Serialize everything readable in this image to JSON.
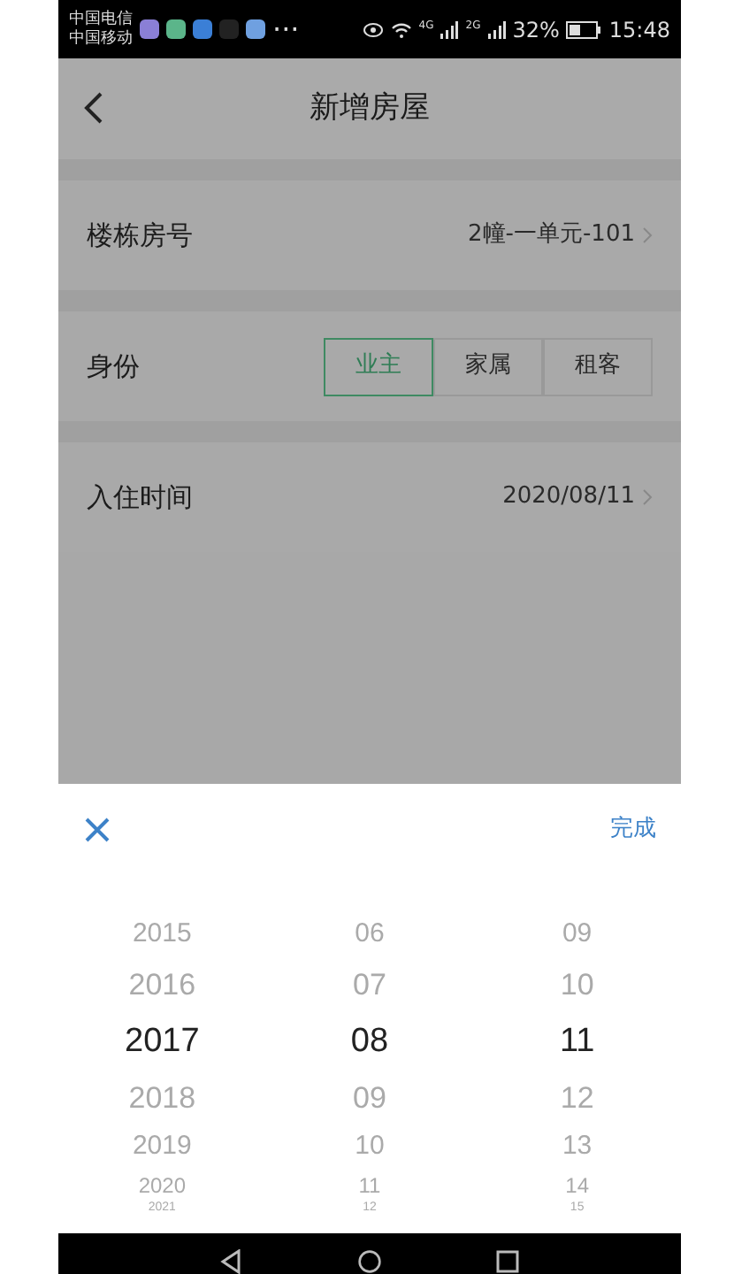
{
  "status_bar": {
    "carriers": [
      "中国电信",
      "中国移动"
    ],
    "more": "···",
    "signal_labels": [
      "4G",
      "2G"
    ],
    "battery": "32%",
    "time": "15:48"
  },
  "header": {
    "title": "新增房屋"
  },
  "form": [
    {
      "kind": "value",
      "label": "楼栋房号",
      "value": "2幢-一单元-101"
    },
    {
      "kind": "segmented",
      "label": "身份",
      "options": [
        {
          "label": "业主",
          "selected": true
        },
        {
          "label": "家属",
          "selected": false
        },
        {
          "label": "租客",
          "selected": false
        }
      ]
    },
    {
      "kind": "value",
      "label": "入住时间",
      "value": "2020/08/11"
    }
  ],
  "sheet": {
    "confirm": "完成",
    "columns": [
      {
        "items": [
          {
            "text": "2015",
            "selected": false
          },
          {
            "text": "2016",
            "selected": false
          },
          {
            "text": "2017",
            "selected": true
          },
          {
            "text": "2018",
            "selected": false
          },
          {
            "text": "2019",
            "selected": false
          },
          {
            "text": "2020",
            "selected": false
          },
          {
            "text": "2021",
            "selected": false
          }
        ]
      },
      {
        "items": [
          {
            "text": "06",
            "selected": false
          },
          {
            "text": "07",
            "selected": false
          },
          {
            "text": "08",
            "selected": true
          },
          {
            "text": "09",
            "selected": false
          },
          {
            "text": "10",
            "selected": false
          },
          {
            "text": "11",
            "selected": false
          },
          {
            "text": "12",
            "selected": false
          }
        ]
      },
      {
        "items": [
          {
            "text": "09",
            "selected": false
          },
          {
            "text": "10",
            "selected": false
          },
          {
            "text": "11",
            "selected": true
          },
          {
            "text": "12",
            "selected": false
          },
          {
            "text": "13",
            "selected": false
          },
          {
            "text": "14",
            "selected": false
          },
          {
            "text": "15",
            "selected": false
          }
        ]
      }
    ]
  }
}
